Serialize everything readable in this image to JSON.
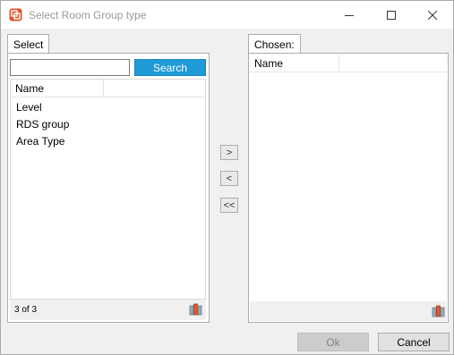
{
  "window": {
    "title": "Select Room Group type",
    "icon": "room-group-app-icon",
    "controls": {
      "minimize_icon": "minimize-icon",
      "maximize_icon": "maximize-icon",
      "close_icon": "close-icon"
    }
  },
  "select_panel": {
    "tab_label": "Select",
    "search": {
      "value": "",
      "placeholder": "",
      "button_label": "Search"
    },
    "columns": [
      "Name",
      ""
    ],
    "items": [
      {
        "name": "Level"
      },
      {
        "name": "RDS group"
      },
      {
        "name": "Area Type"
      }
    ],
    "count_text": "3 of 3",
    "footer_icon": "column-chooser-icon"
  },
  "transfer_buttons": {
    "add_label": ">",
    "remove_label": "<",
    "remove_all_label": "<<"
  },
  "chosen_panel": {
    "tab_label": "Chosen:",
    "columns": [
      "Name",
      ""
    ],
    "items": [],
    "footer_icon": "column-chooser-icon"
  },
  "dialog_buttons": {
    "ok_label": "Ok",
    "ok_enabled": false,
    "cancel_label": "Cancel"
  },
  "colors": {
    "accent": "#1e9ad6",
    "app_icon": "#d9542b",
    "window_bg": "#f0f0f0",
    "title_text": "#9a9a9a"
  }
}
